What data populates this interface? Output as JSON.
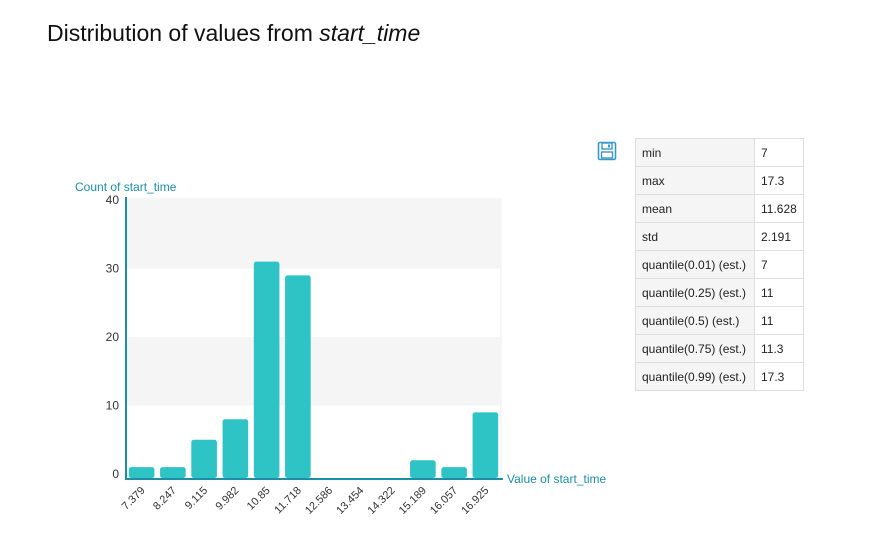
{
  "title": {
    "prefix": "Distribution of values from ",
    "field": "start_time"
  },
  "save_icon": "floppy-disk-icon",
  "colors": {
    "bar": "#2ec4c6",
    "axis": "#1a8fa6",
    "label": "#1a8fa6",
    "grid_band": "#f5f5f5"
  },
  "stats": [
    {
      "label": "min",
      "value": "7"
    },
    {
      "label": "max",
      "value": "17.3"
    },
    {
      "label": "mean",
      "value": "11.628"
    },
    {
      "label": "std",
      "value": "2.191"
    },
    {
      "label": "quantile(0.01) (est.)",
      "value": "7"
    },
    {
      "label": "quantile(0.25) (est.)",
      "value": "11"
    },
    {
      "label": "quantile(0.5) (est.)",
      "value": "11"
    },
    {
      "label": "quantile(0.75) (est.)",
      "value": "11.3"
    },
    {
      "label": "quantile(0.99) (est.)",
      "value": "17.3"
    }
  ],
  "chart_data": {
    "type": "bar",
    "xlabel": "Value of start_time",
    "ylabel": "Count of start_time",
    "categories": [
      "7.379",
      "8.247",
      "9.115",
      "9.982",
      "10.85",
      "11.718",
      "12.586",
      "13.454",
      "14.322",
      "15.189",
      "16.057",
      "16.925"
    ],
    "values": [
      1,
      1,
      5,
      8,
      31,
      29,
      0,
      0,
      0,
      2,
      1,
      9
    ],
    "yticks": [
      0,
      10,
      20,
      30,
      40
    ],
    "ylim": [
      0,
      40
    ],
    "grid": "alternating bands",
    "legend": "none"
  }
}
